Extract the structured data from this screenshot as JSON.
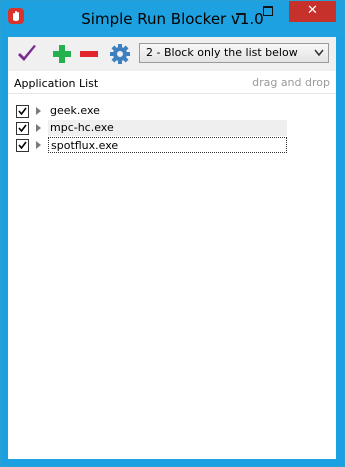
{
  "window": {
    "title": "Simple Run Blocker v1.0",
    "close_glyph": "✕"
  },
  "toolbar": {
    "mode_select": {
      "selected": "2 - Block only the list below"
    }
  },
  "list": {
    "header": "Application List",
    "hint": "drag and drop",
    "items": [
      {
        "name": "geek.exe",
        "checked": true
      },
      {
        "name": "mpc-hc.exe",
        "checked": true
      },
      {
        "name": "spotflux.exe",
        "checked": true
      }
    ]
  },
  "colors": {
    "titlebar": "#1da1e0",
    "close": "#c7312b",
    "check_purple": "#7a2a8e",
    "add_green": "#22b14c",
    "remove_red": "#e3262e",
    "gear_blue": "#3d7fc1",
    "app_icon": "#d9342b"
  },
  "icons": {
    "app": "stop-hand-icon",
    "check": "checkmark-icon",
    "add": "plus-icon",
    "remove": "minus-icon",
    "settings": "gear-icon",
    "dropdown": "chevron-down-icon",
    "expander": "triangle-right-icon",
    "checkbox": "checkbox-checked-icon"
  }
}
